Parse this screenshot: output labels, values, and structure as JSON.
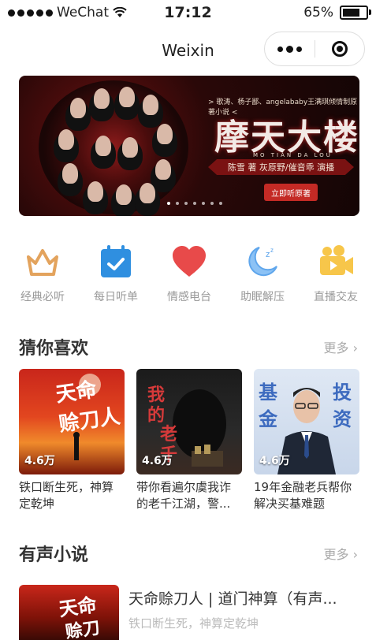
{
  "status_bar": {
    "carrier": "WeChat",
    "time": "17:12",
    "battery": "65%",
    "battery_level": 0.65
  },
  "nav": {
    "title": "Weixin"
  },
  "banner": {
    "subtitle": "> 歌涛、杨子鄙、angelababy王满琪倾情制原著小说 <",
    "title": "摩天大楼",
    "pinyin": "MO TIAN DA LOU",
    "credit": "陈雪 著   灰原野/催音乖 演播",
    "button": "立即听原著",
    "dot_count": 7,
    "active_dot": 0
  },
  "categories": [
    {
      "label": "经典必听",
      "icon": "crown-icon"
    },
    {
      "label": "每日听单",
      "icon": "calendar-check-icon"
    },
    {
      "label": "情感电台",
      "icon": "heart-icon"
    },
    {
      "label": "助眠解压",
      "icon": "moon-sleep-icon"
    },
    {
      "label": "直播交友",
      "icon": "video-camera-icon"
    }
  ],
  "guess": {
    "title": "猜你喜欢",
    "more": "更多 ›",
    "items": [
      {
        "count": "4.6万",
        "title": "铁口断生死，神算定乾坤",
        "cover_text": "天命赊刀人"
      },
      {
        "count": "4.6万",
        "title": "带你看遍尔虞我诈的老千江湖，警...",
        "cover_text": "我的老千生涯"
      },
      {
        "count": "4.6万",
        "title": "19年金融老兵帮你解决买基难题",
        "cover_text": "基金投资"
      }
    ]
  },
  "novels": {
    "title": "有声小说",
    "more": "更多 ›",
    "items": [
      {
        "title": "天命赊刀人 | 道门神算（有声...",
        "desc": "铁口断生死，神算定乾坤",
        "cover_text": "天命"
      }
    ]
  },
  "colors": {
    "accent_red": "#e84a4a",
    "crown": "#e3a35d",
    "calendar": "#2f8fe0",
    "moon": "#6aaef0",
    "video": "#f7c64a"
  }
}
